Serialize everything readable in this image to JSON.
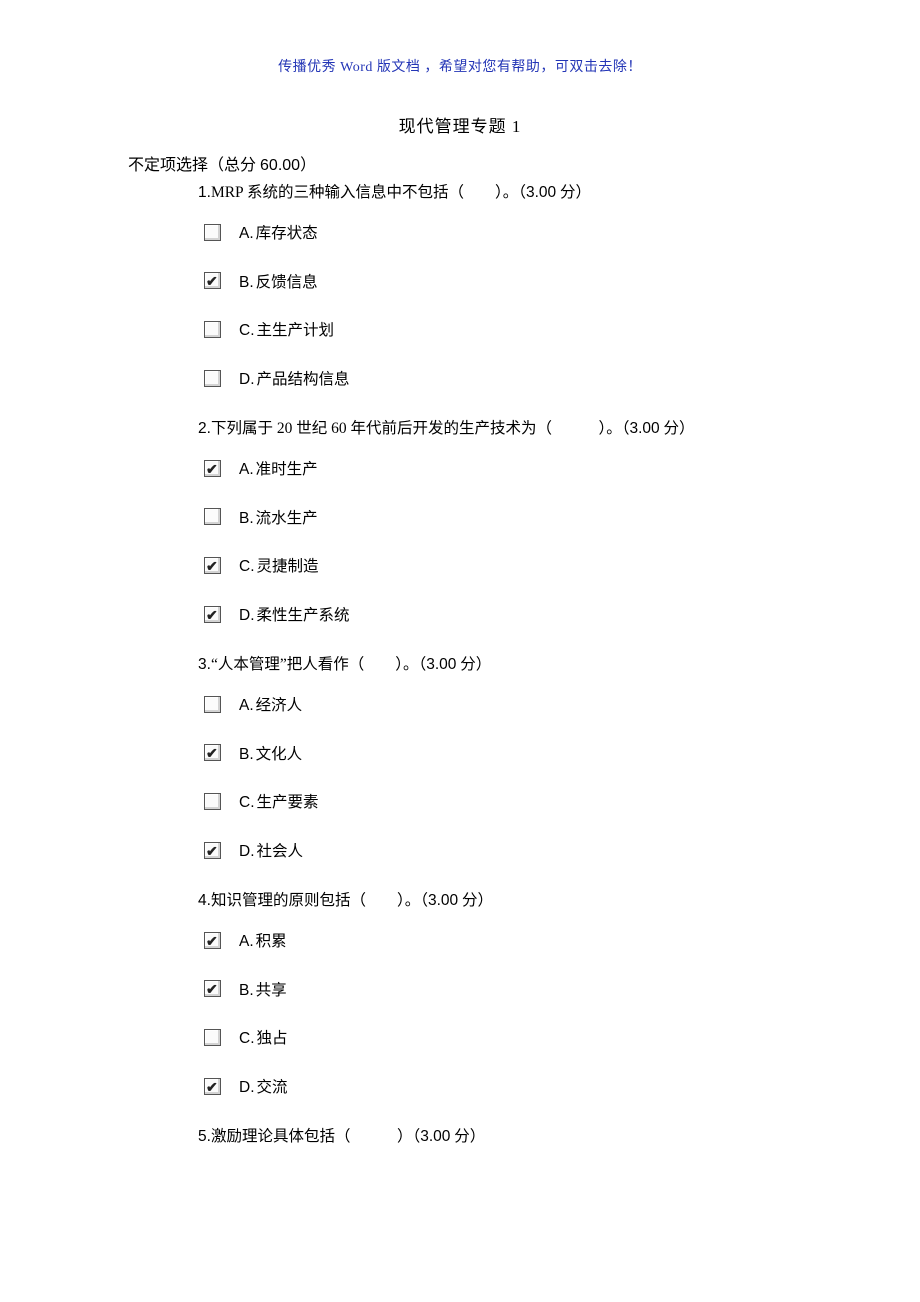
{
  "header_note": "传播优秀 Word 版文档 ，希望对您有帮助，可双击去除！",
  "title": "现代管理专题 1",
  "section_title_prefix": "不定项选择（总分 ",
  "section_title_score": "60.00",
  "section_title_suffix": "）",
  "questions": [
    {
      "num": "1.",
      "text_pre": "MRP 系统的三种输入信息中不包括（　　）。（",
      "points": "3.00",
      "text_post": " 分）",
      "options": [
        {
          "letter": "A.",
          "text": "库存状态",
          "checked": false
        },
        {
          "letter": "B.",
          "text": "反馈信息",
          "checked": true
        },
        {
          "letter": "C.",
          "text": "主生产计划",
          "checked": false
        },
        {
          "letter": "D.",
          "text": "产品结构信息",
          "checked": false
        }
      ]
    },
    {
      "num": "2.",
      "text_pre": "下列属于 20 世纪 60 年代前后开发的生产技术为（　　　）。（",
      "points": "3.00",
      "text_post": " 分）",
      "options": [
        {
          "letter": "A.",
          "text": "准时生产",
          "checked": true
        },
        {
          "letter": "B.",
          "text": "流水生产",
          "checked": false
        },
        {
          "letter": "C.",
          "text": "灵捷制造",
          "checked": true
        },
        {
          "letter": "D.",
          "text": "柔性生产系统",
          "checked": true
        }
      ]
    },
    {
      "num": "3.",
      "text_pre": "“人本管理”把人看作（　　）。（",
      "points": "3.00",
      "text_post": " 分）",
      "options": [
        {
          "letter": "A.",
          "text": "经济人",
          "checked": false
        },
        {
          "letter": "B.",
          "text": "文化人",
          "checked": true
        },
        {
          "letter": "C.",
          "text": "生产要素",
          "checked": false
        },
        {
          "letter": "D.",
          "text": "社会人",
          "checked": true
        }
      ]
    },
    {
      "num": "4.",
      "text_pre": "知识管理的原则包括（　　）。（",
      "points": "3.00",
      "text_post": " 分）",
      "options": [
        {
          "letter": "A.",
          "text": "积累",
          "checked": true
        },
        {
          "letter": "B.",
          "text": "共享",
          "checked": true
        },
        {
          "letter": "C.",
          "text": "独占",
          "checked": false
        },
        {
          "letter": "D.",
          "text": "交流",
          "checked": true
        }
      ]
    },
    {
      "num": "5.",
      "text_pre": "激励理论具体包括（　　　）（",
      "points": "3.00",
      "text_post": " 分）",
      "options": []
    }
  ]
}
